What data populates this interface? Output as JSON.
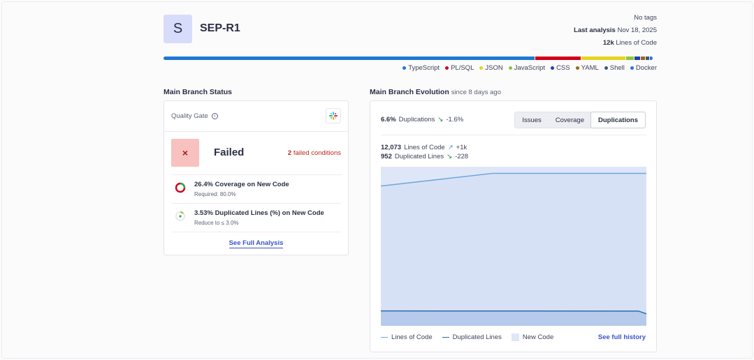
{
  "project": {
    "avatar_letter": "S",
    "name": "SEP-R1"
  },
  "meta": {
    "tags": "No tags",
    "last_analysis_label": "Last analysis",
    "last_analysis_date": "Nov 18, 2025",
    "loc_value": "12k",
    "loc_label": "Lines of Code"
  },
  "languages": [
    {
      "name": "TypeScript",
      "color": "#1f78d1",
      "share": 0.76
    },
    {
      "name": "PL/SQL",
      "color": "#d0021b",
      "share": 0.093
    },
    {
      "name": "JSON",
      "color": "#e6d31e",
      "share": 0.09
    },
    {
      "name": "JavaScript",
      "color": "#8cc63f",
      "share": 0.015
    },
    {
      "name": "CSS",
      "color": "#1e3fa8",
      "share": 0.012
    },
    {
      "name": "YAML",
      "color": "#a0651b",
      "share": 0.008
    },
    {
      "name": "Shell",
      "color": "#3c5a78",
      "share": 0.007
    },
    {
      "name": "Docker",
      "color": "#2d6fe0",
      "share": 0.007
    }
  ],
  "status": {
    "title": "Main Branch Status",
    "quality_gate_label": "Quality Gate",
    "info_glyph": "i",
    "fail_glyph": "×",
    "result": "Failed",
    "failed_count": "2",
    "failed_label": "failed conditions",
    "conditions": [
      {
        "title": "26.4% Coverage on New Code",
        "sub": "Required: 80.0%",
        "value": 0.264
      },
      {
        "title": "3.53% Duplicated Lines (%) on New Code",
        "sub": "Reduce to ≤ 3.0%",
        "value": 0.0353
      }
    ],
    "see_full": "See Full Analysis"
  },
  "evolution": {
    "title": "Main Branch Evolution",
    "since": "since 8 days ago",
    "dup_value": "6.6%",
    "dup_label": "Duplications",
    "dup_delta": "-1.6%",
    "tabs": [
      "Issues",
      "Coverage",
      "Duplications"
    ],
    "active_tab": "Duplications",
    "loc_value": "12,073",
    "loc_label": "Lines of Code",
    "loc_delta": "+1k",
    "dl_value": "952",
    "dl_label": "Duplicated Lines",
    "dl_delta": "-228",
    "legend": [
      "Lines of Code",
      "Duplicated Lines",
      "New Code"
    ],
    "see_history": "See full history",
    "colors": {
      "loc": "#6fa8dc",
      "dup": "#2a6bb0",
      "new_code": "#dfe6f8"
    }
  },
  "chart_data": {
    "type": "line",
    "series": [
      {
        "name": "Lines of Code",
        "x": [
          0,
          0.42,
          1
        ],
        "values": [
          11073,
          12073,
          12073
        ]
      },
      {
        "name": "Duplicated Lines",
        "x": [
          0,
          0.97,
          1
        ],
        "values": [
          1180,
          1170,
          952
        ]
      }
    ],
    "shaded_region": "New Code",
    "ylim": [
      0,
      12600
    ]
  }
}
